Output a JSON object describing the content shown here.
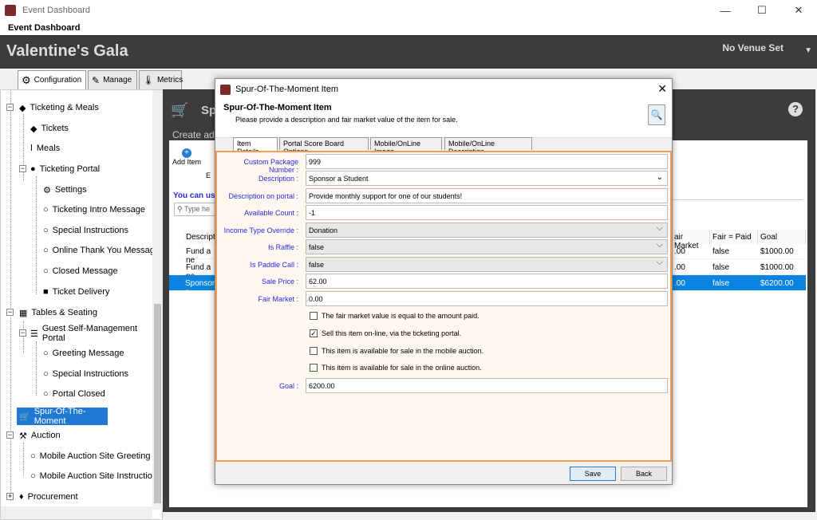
{
  "window": {
    "title": "Event Dashboard",
    "menu": "Event Dashboard"
  },
  "header": {
    "event_name": "Valentine's Gala",
    "venue": "No Venue Set"
  },
  "main_tabs": [
    {
      "label": "Configuration",
      "icon": "gears-icon"
    },
    {
      "label": "Manage",
      "icon": "pencil-icon"
    },
    {
      "label": "Metrics",
      "icon": "thermometer-icon"
    }
  ],
  "sidebar": {
    "items": [
      {
        "label": "Ticketing & Meals",
        "icon": "tag-icon"
      },
      {
        "label": "Tickets",
        "icon": "tag-icon"
      },
      {
        "label": "Meals",
        "icon": "fork-icon"
      },
      {
        "label": "Ticketing Portal",
        "icon": "globe-icon"
      },
      {
        "label": "Settings",
        "icon": "gear-icon"
      },
      {
        "label": "Ticketing Intro Message",
        "icon": "speech-bubble-icon"
      },
      {
        "label": "Special Instructions",
        "icon": "speech-bubble-icon"
      },
      {
        "label": "Online Thank You Message",
        "icon": "speech-bubble-icon"
      },
      {
        "label": "Closed Message",
        "icon": "speech-bubble-icon"
      },
      {
        "label": "Ticket Delivery",
        "icon": "truck-icon"
      },
      {
        "label": "Tables & Seating",
        "icon": "table-icon"
      },
      {
        "label": "Guest Self-Management Portal",
        "icon": "list-icon"
      },
      {
        "label": "Greeting Message",
        "icon": "speech-bubble-icon"
      },
      {
        "label": "Special Instructions",
        "icon": "speech-bubble-icon"
      },
      {
        "label": "Portal Closed",
        "icon": "speech-bubble-icon"
      },
      {
        "label": "Spur-Of-The-Moment",
        "icon": "cart-icon"
      },
      {
        "label": "Auction",
        "icon": "gavel-icon"
      },
      {
        "label": "Mobile Auction Site Greeting",
        "icon": "speech-bubble-icon"
      },
      {
        "label": "Mobile Auction Site Instruction",
        "icon": "speech-bubble-icon"
      },
      {
        "label": "Procurement",
        "icon": "gift-icon"
      }
    ]
  },
  "main": {
    "title_partial": "Sp",
    "subtitle_partial": "Create add",
    "add_item": "Add Item",
    "edit_partial": "E",
    "you_can_use": "You can use",
    "search_placeholder": "Type he",
    "grid": {
      "headers": [
        "Descripti",
        "air Market",
        "Fair = Paid",
        "Goal"
      ],
      "rows": [
        [
          "Fund a ne",
          ".00",
          "false",
          "$1000.00"
        ],
        [
          "Fund a ne",
          ".00",
          "false",
          "$1000.00"
        ],
        [
          "Sponsor a",
          ".00",
          "false",
          "$6200.00"
        ]
      ]
    }
  },
  "dialog": {
    "title": "Spur-Of-The-Moment Item",
    "heading": "Spur-Of-The-Moment Item",
    "subheading": "Please provide a description and fair market value of the item for sale.",
    "tabs": [
      "Item Details",
      "Portal Score Board Options",
      "Mobile/OnLine Image",
      "Mobile/OnLine Description"
    ],
    "fields": {
      "custom_package_number": {
        "label": "Custom Package Number :",
        "value": "999"
      },
      "description": {
        "label": "Description :",
        "value": "Sponsor a Student"
      },
      "description_portal": {
        "label": "Description on portal :",
        "value": "Provide monthly support for one of our students!"
      },
      "available_count": {
        "label": "Available Count :",
        "value": "-1"
      },
      "income_type": {
        "label": "Income Type Override :",
        "value": "Donation"
      },
      "is_raffle": {
        "label": "Is Raffle :",
        "value": "false"
      },
      "is_paddle_call": {
        "label": "Is Paddle Call :",
        "value": "false"
      },
      "sale_price": {
        "label": "Sale Price :",
        "value": "62.00"
      },
      "fair_market": {
        "label": "Fair Market :",
        "value": "0.00"
      },
      "goal": {
        "label": "Goal :",
        "value": "6200.00"
      }
    },
    "checkboxes": [
      {
        "label": "The fair market value is equal to the amount paid.",
        "checked": false
      },
      {
        "label": "Sell this item on-line, via the ticketing portal.",
        "checked": true
      },
      {
        "label": "This item is available for sale in the mobile auction.",
        "checked": false
      },
      {
        "label": "This item is available for sale in the online auction.",
        "checked": false
      }
    ],
    "save": "Save",
    "back": "Back"
  }
}
